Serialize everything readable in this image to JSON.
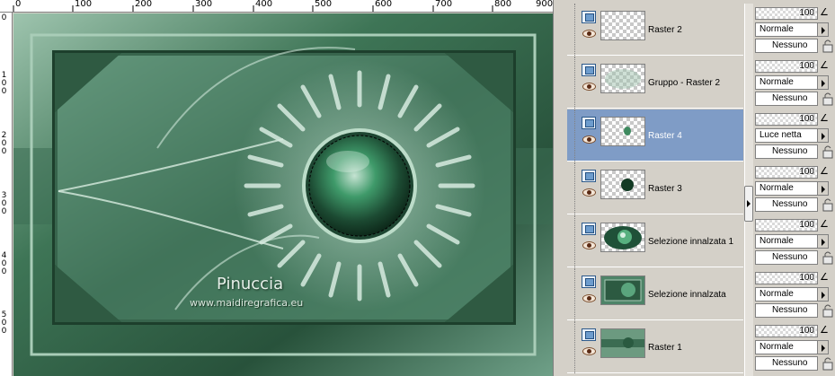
{
  "ruler": {
    "top_labels": [
      "0",
      "100",
      "200",
      "300",
      "400",
      "500",
      "600",
      "700",
      "800",
      "900"
    ],
    "left_labels": [
      "0",
      "1\n0\n0",
      "2\n0\n0",
      "3\n0\n0",
      "4\n0\n0",
      "5\n0\n0"
    ]
  },
  "canvas": {
    "watermark_title": "Pinuccia",
    "watermark_url": "www.maidiregrafica.eu"
  },
  "layers": [
    {
      "name": "Raster 2",
      "thumb": "empty",
      "opacity": "100",
      "blend": "Normale",
      "group": "Nessuno",
      "selected": false
    },
    {
      "name": "Gruppo - Raster 2",
      "thumb": "faint",
      "opacity": "100",
      "blend": "Normale",
      "group": "Nessuno",
      "selected": false
    },
    {
      "name": "Raster 4",
      "thumb": "small-dot",
      "opacity": "100",
      "blend": "Luce netta",
      "group": "Nessuno",
      "selected": true
    },
    {
      "name": "Raster 3",
      "thumb": "dot",
      "opacity": "100",
      "blend": "Normale",
      "group": "Nessuno",
      "selected": false
    },
    {
      "name": "Selezione innalzata 1",
      "thumb": "eye-ball",
      "opacity": "100",
      "blend": "Normale",
      "group": "Nessuno",
      "selected": false
    },
    {
      "name": "Selezione innalzata",
      "thumb": "image",
      "opacity": "100",
      "blend": "Normale",
      "group": "Nessuno",
      "selected": false
    },
    {
      "name": "Raster 1",
      "thumb": "image",
      "opacity": "100",
      "blend": "Normale",
      "group": "Nessuno",
      "selected": false
    }
  ],
  "colors": {
    "selected_row": "#7f9cc6",
    "canvas_green": "#2f5d44",
    "accent_green": "#3f9a6a"
  }
}
